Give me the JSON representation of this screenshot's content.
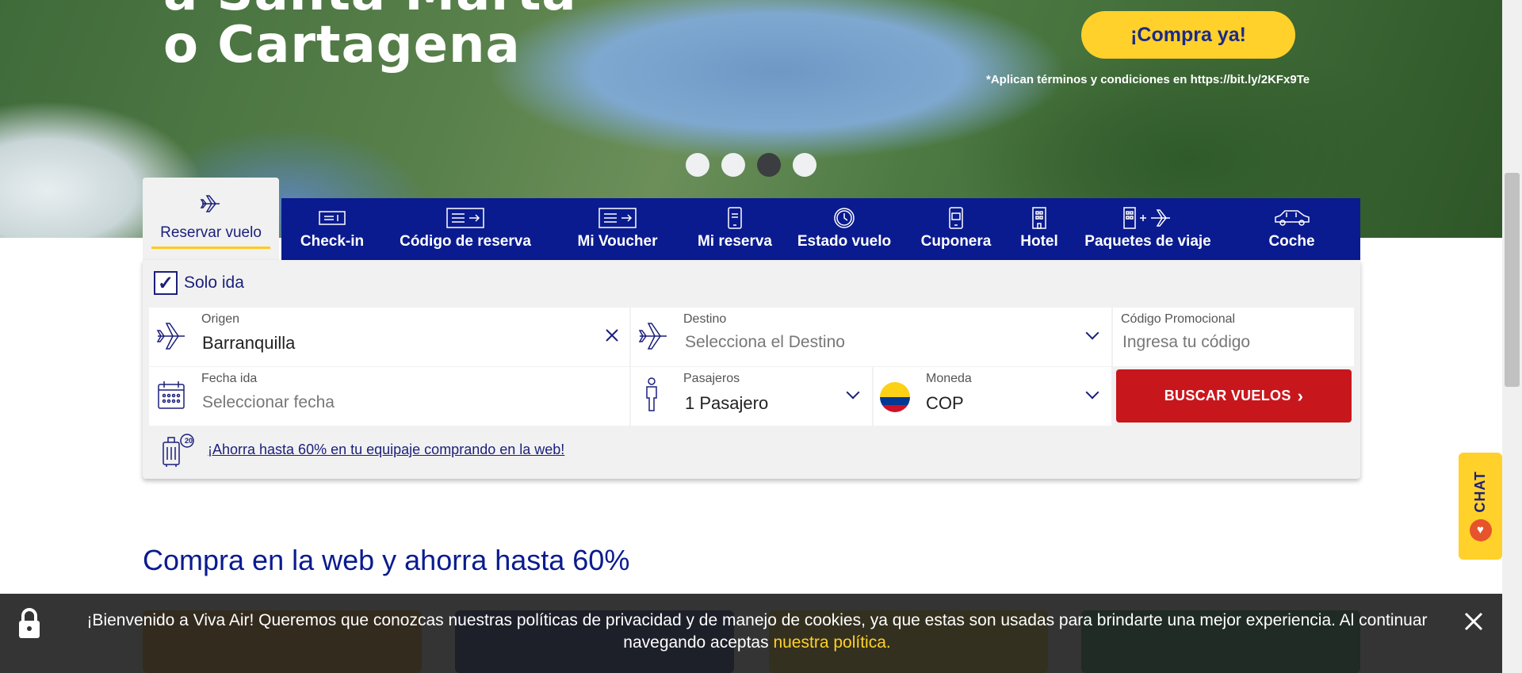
{
  "hero": {
    "title_line1": "a Santa Marta",
    "title_line2": "o Cartagena",
    "cta_label": "¡Compra ya!",
    "terms": "*Aplican términos y condiciones en https://bit.ly/2KFx9Te",
    "slides": 4,
    "active_slide_index": 2
  },
  "tabs": {
    "active": {
      "label": "Reservar vuelo",
      "icon": "plane-icon"
    },
    "items": [
      {
        "label": "Check-in",
        "icon": "boarding-pass-icon"
      },
      {
        "label": "Código de reserva",
        "icon": "ticket-icon"
      },
      {
        "label": "Mi Voucher",
        "icon": "voucher-icon"
      },
      {
        "label": "Mi reserva",
        "icon": "phone-icon"
      },
      {
        "label": "Estado vuelo",
        "icon": "clock-icon"
      },
      {
        "label": "Cuponera",
        "icon": "coupon-phone-icon"
      },
      {
        "label": "Hotel",
        "icon": "hotel-icon"
      },
      {
        "label": "Paquetes de viaje",
        "icon": "hotel-plus-plane-icon"
      },
      {
        "label": "Coche",
        "icon": "car-icon"
      }
    ]
  },
  "search": {
    "solo_ida_label": "Solo ida",
    "solo_ida_checked": true,
    "origin_label": "Origen",
    "origin_value": "Barranquilla",
    "destination_label": "Destino",
    "destination_placeholder": "Selecciona el Destino",
    "promo_label": "Código Promocional",
    "promo_placeholder": "Ingresa tu código",
    "date_label": "Fecha ida",
    "date_placeholder": "Seleccionar fecha",
    "passengers_label": "Pasajeros",
    "passengers_value": "1 Pasajero",
    "currency_label": "Moneda",
    "currency_value": "COP",
    "search_button": "BUSCAR VUELOS",
    "search_chevron": "›",
    "luggage_badge": "20",
    "baggage_promo": "¡Ahorra hasta 60% en tu equipaje comprando en la web!"
  },
  "section": {
    "title": "Compra en la web y ahorra hasta 60%"
  },
  "chat": {
    "label": "CHAT"
  },
  "cookie": {
    "message": "¡Bienvenido a Viva Air! Queremos que conozcas nuestras políticas de privacidad y de manejo de cookies, ya que estas son usadas para brindarte una mejor experiencia. Al continuar navegando aceptas",
    "link": "nuestra política."
  },
  "colors": {
    "brand_blue": "#0a1b8f",
    "brand_yellow": "#ffd12a",
    "search_red": "#c8161d"
  }
}
